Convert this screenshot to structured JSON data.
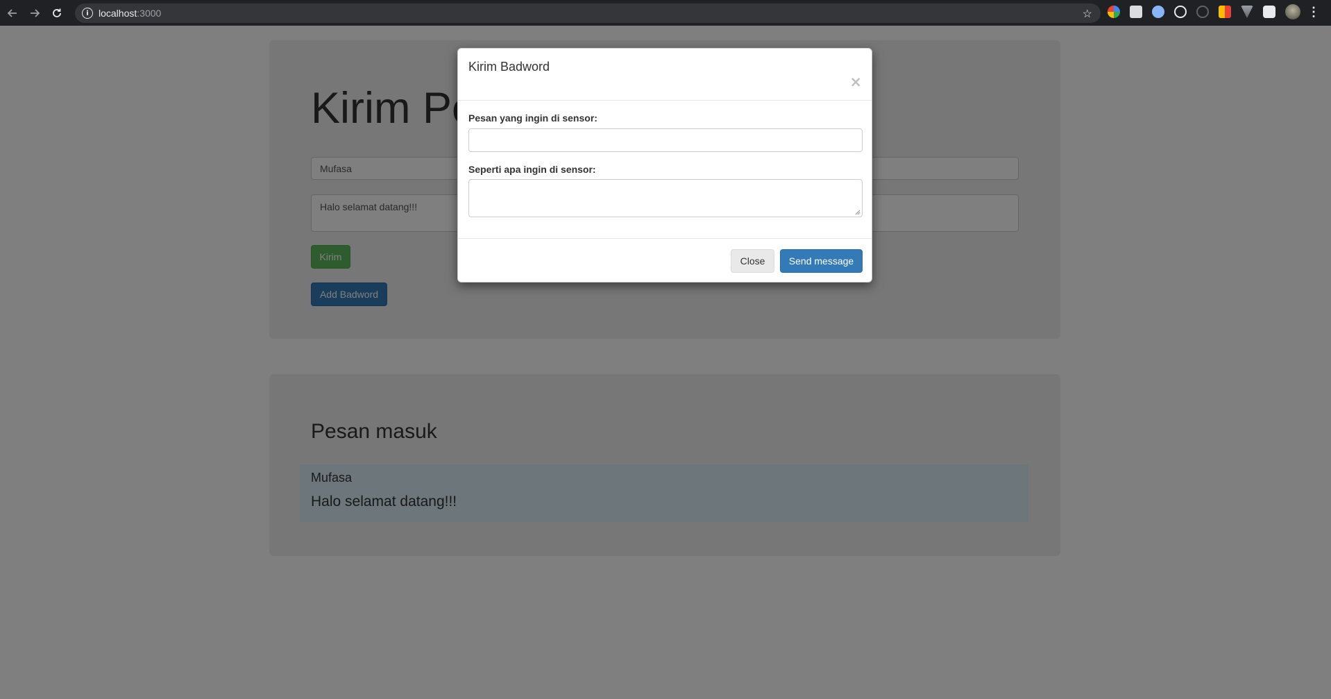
{
  "browser": {
    "url_host": "localhost",
    "url_port": ":3000"
  },
  "form": {
    "title": "Kirim Pe",
    "name_value": "Mufasa",
    "message_value": "Halo selamat datang!!!",
    "submit_label": "Kirim",
    "add_badword_label": "Add Badword"
  },
  "inbox": {
    "title": "Pesan masuk",
    "messages": [
      {
        "sender": "Mufasa",
        "text": "Halo selamat datang!!!"
      }
    ]
  },
  "modal": {
    "title": "Kirim Badword",
    "close_symbol": "×",
    "field1_label": "Pesan yang ingin di sensor:",
    "field1_value": "",
    "field2_label": "Seperti apa ingin di sensor:",
    "field2_value": "",
    "close_label": "Close",
    "send_label": "Send message"
  },
  "colors": {
    "success": "#5cb85c",
    "primary": "#337ab7",
    "inbox_bg": "#d9edf7",
    "jumbotron_bg": "#eeeeee"
  }
}
